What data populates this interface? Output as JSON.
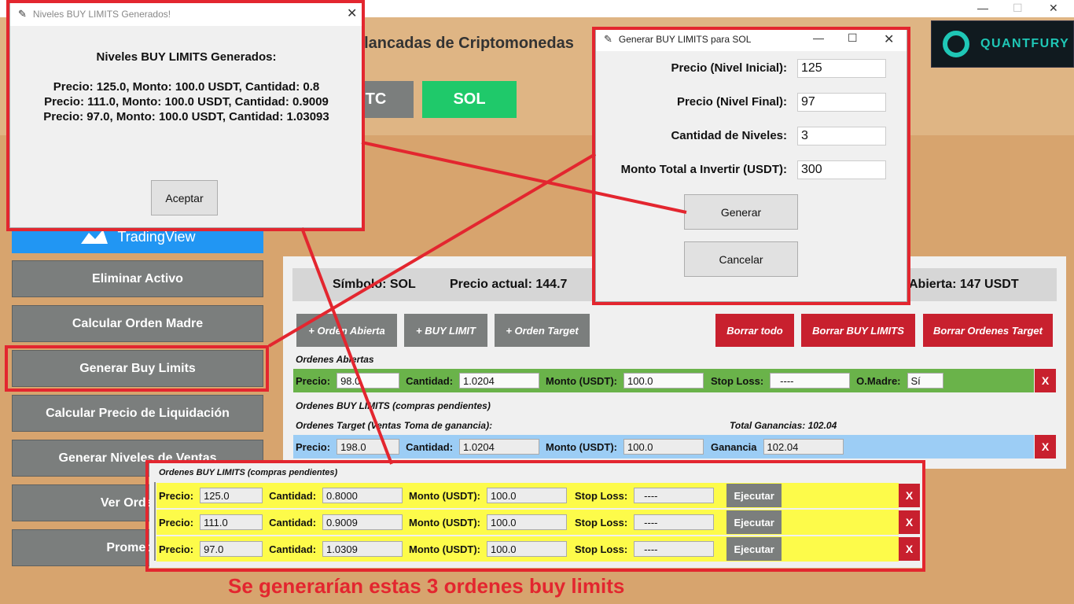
{
  "window_controls": {
    "minimize": "—",
    "maximize": "☐",
    "close": "✕"
  },
  "app_title": "alancadas de Criptomonedas",
  "quantfury": {
    "brand": "QUANTFURY",
    "accent": "#1fc7b6"
  },
  "coins": [
    {
      "label": "TC",
      "color": "#7b7e7d"
    },
    {
      "label": "SOL",
      "color": "#1fc96a"
    }
  ],
  "sidebar": {
    "tradingview": "TradingView",
    "items": [
      "Eliminar Activo",
      "Calcular Orden Madre",
      "Generar Buy Limits",
      "Calcular Precio de Liquidación",
      "Generar Niveles de Ventas",
      "Ver Ordenes",
      "Promediar"
    ]
  },
  "info_bar": {
    "symbol": "Símbolo: SOL",
    "price": "Precio actual: 144.7",
    "open": "Abierta: 147 USDT"
  },
  "action_buttons": {
    "add_open": "+ Orden Abierta",
    "add_buy_limit": "+ BUY LIMIT",
    "add_target": "+ Orden Target",
    "clear_all": "Borrar todo",
    "clear_buy_limits": "Borrar BUY LIMITS",
    "clear_targets": "Borrar Ordenes Target"
  },
  "open_orders": {
    "title": "Ordenes Abiertas",
    "row": {
      "price_label": "Precio:",
      "price": "98.0",
      "qty_label": "Cantidad:",
      "qty": "1.0204",
      "amount_label": "Monto (USDT):",
      "amount": "100.0",
      "sl_label": "Stop Loss:",
      "sl": "----",
      "mother_label": "O.Madre:",
      "mother": "Sí",
      "delete": "X"
    }
  },
  "buy_limits_section_title": "Ordenes BUY LIMITS (compras pendientes)",
  "target_orders": {
    "title": "Ordenes Target (Ventas Toma de ganancia):",
    "total": "Total Ganancias: 102.04",
    "row": {
      "price_label": "Precio:",
      "price": "198.0",
      "qty_label": "Cantidad:",
      "qty": "1.0204",
      "amount_label": "Monto (USDT):",
      "amount": "100.0",
      "gain_label": "Ganancia",
      "gain": "102.04",
      "delete": "X"
    }
  },
  "buy_limits_popup": {
    "title": "Ordenes BUY LIMITS (compras pendientes)",
    "labels": {
      "price": "Precio:",
      "qty": "Cantidad:",
      "amount": "Monto (USDT):",
      "sl": "Stop Loss:",
      "exec": "Ejecutar",
      "delete": "X"
    },
    "rows": [
      {
        "price": "125.0",
        "qty": "0.8000",
        "amount": "100.0",
        "sl": "----"
      },
      {
        "price": "111.0",
        "qty": "0.9009",
        "amount": "100.0",
        "sl": "----"
      },
      {
        "price": "97.0",
        "qty": "1.0309",
        "amount": "100.0",
        "sl": "----"
      }
    ]
  },
  "levels_dialog": {
    "title": "Niveles BUY LIMITS Generados!",
    "heading": "Niveles BUY LIMITS Generados:",
    "lines": [
      "Precio: 125.0, Monto: 100.0 USDT, Cantidad: 0.8",
      "Precio: 111.0, Monto: 100.0 USDT, Cantidad: 0.9009",
      "Precio: 97.0, Monto: 100.0 USDT, Cantidad: 1.03093"
    ],
    "accept": "Aceptar",
    "close": "✕"
  },
  "generate_dialog": {
    "title": "Generar BUY LIMITS para SOL",
    "fields": [
      {
        "label": "Precio (Nivel Inicial):",
        "value": "125"
      },
      {
        "label": "Precio (Nivel Final):",
        "value": "97"
      },
      {
        "label": "Cantidad de Niveles:",
        "value": "3"
      },
      {
        "label": "Monto Total a Invertir (USDT):",
        "value": "300"
      }
    ],
    "generate": "Generar",
    "cancel": "Cancelar",
    "controls": {
      "minimize": "—",
      "maximize": "☐",
      "close": "✕"
    }
  },
  "caption": "Se generarían estas 3 ordenes buy limits",
  "colors": {
    "annotation_red": "#e3262f",
    "green_row": "#6ab34a",
    "blue_row": "#9ccdf5",
    "yellow_row": "#fdfb4a"
  }
}
